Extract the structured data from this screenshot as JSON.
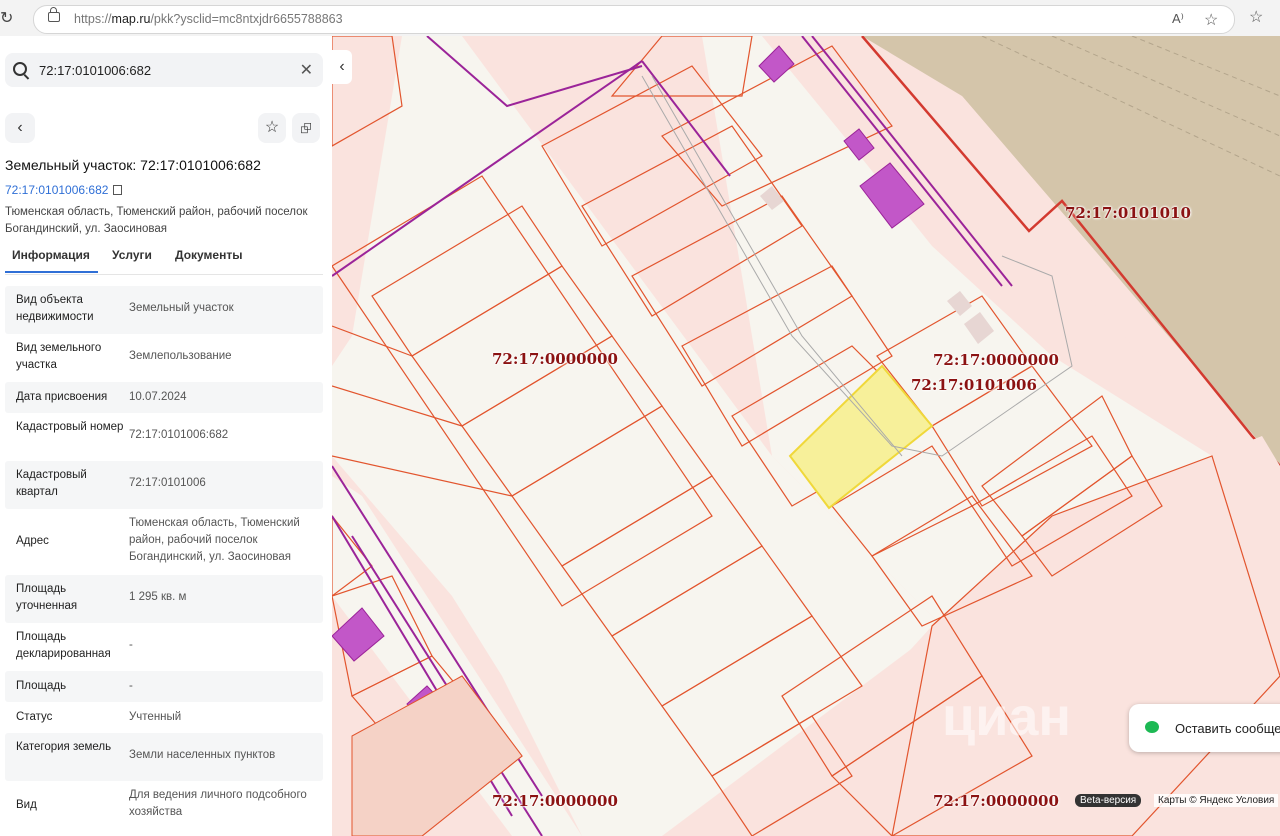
{
  "browser": {
    "url_prefix": "https://",
    "url_host": "map.ru",
    "url_path": "/pkk?ysclid=mc8ntxjdr6655788863"
  },
  "search": {
    "value": "72:17:0101006:682"
  },
  "object": {
    "title": "Земельный участок: 72:17:0101006:682",
    "number": "72:17:0101006:682",
    "address": "Тюменская область, Тюменский район, рабочий поселок Богандинский, ул. Заосиновая"
  },
  "tabs": [
    "Информация",
    "Услуги",
    "Документы"
  ],
  "properties": [
    {
      "k": "Вид объекта недвижимости",
      "v": "Земельный участок"
    },
    {
      "k": "Вид земельного участка",
      "v": "Землепользование"
    },
    {
      "k": "Дата присвоения",
      "v": "10.07.2024"
    },
    {
      "k": "Кадастровый номер",
      "v": "72:17:0101006:682"
    },
    {
      "k": "Кадастровый квартал",
      "v": "72:17:0101006"
    },
    {
      "k": "Адрес",
      "v": "Тюменская область, Тюменский район, рабочий поселок Богандинский, ул. Заосиновая"
    },
    {
      "k": "Площадь уточненная",
      "v": "1 295 кв. м"
    },
    {
      "k": "Площадь декларированная",
      "v": "-"
    },
    {
      "k": "Площадь",
      "v": "-"
    },
    {
      "k": "Статус",
      "v": "Учтенный"
    },
    {
      "k": "Категория земель",
      "v": "Земли населенных пунктов"
    },
    {
      "k": "Вид",
      "v": "Для ведения личного подсобного хозяйства"
    }
  ],
  "map": {
    "labels": [
      "72:17:0101010",
      "72:17:0000000",
      "72:17:0000000",
      "72:17:0101006",
      "72:17:0000000",
      "72:17:0000000"
    ],
    "leave_message": "Оставить сообще",
    "beta": "Beta-версия",
    "copyright": "Карты © Яндекс   Условия",
    "watermark": "циан",
    "colors": {
      "parcel_fill": "#fae3de",
      "parcel_line": "#e2552e",
      "selected": "#f7f09a",
      "road": "#f7f5ef",
      "forest": "#d4c5aa",
      "buildings": "#c257c8",
      "lines": "#9b2499"
    }
  }
}
